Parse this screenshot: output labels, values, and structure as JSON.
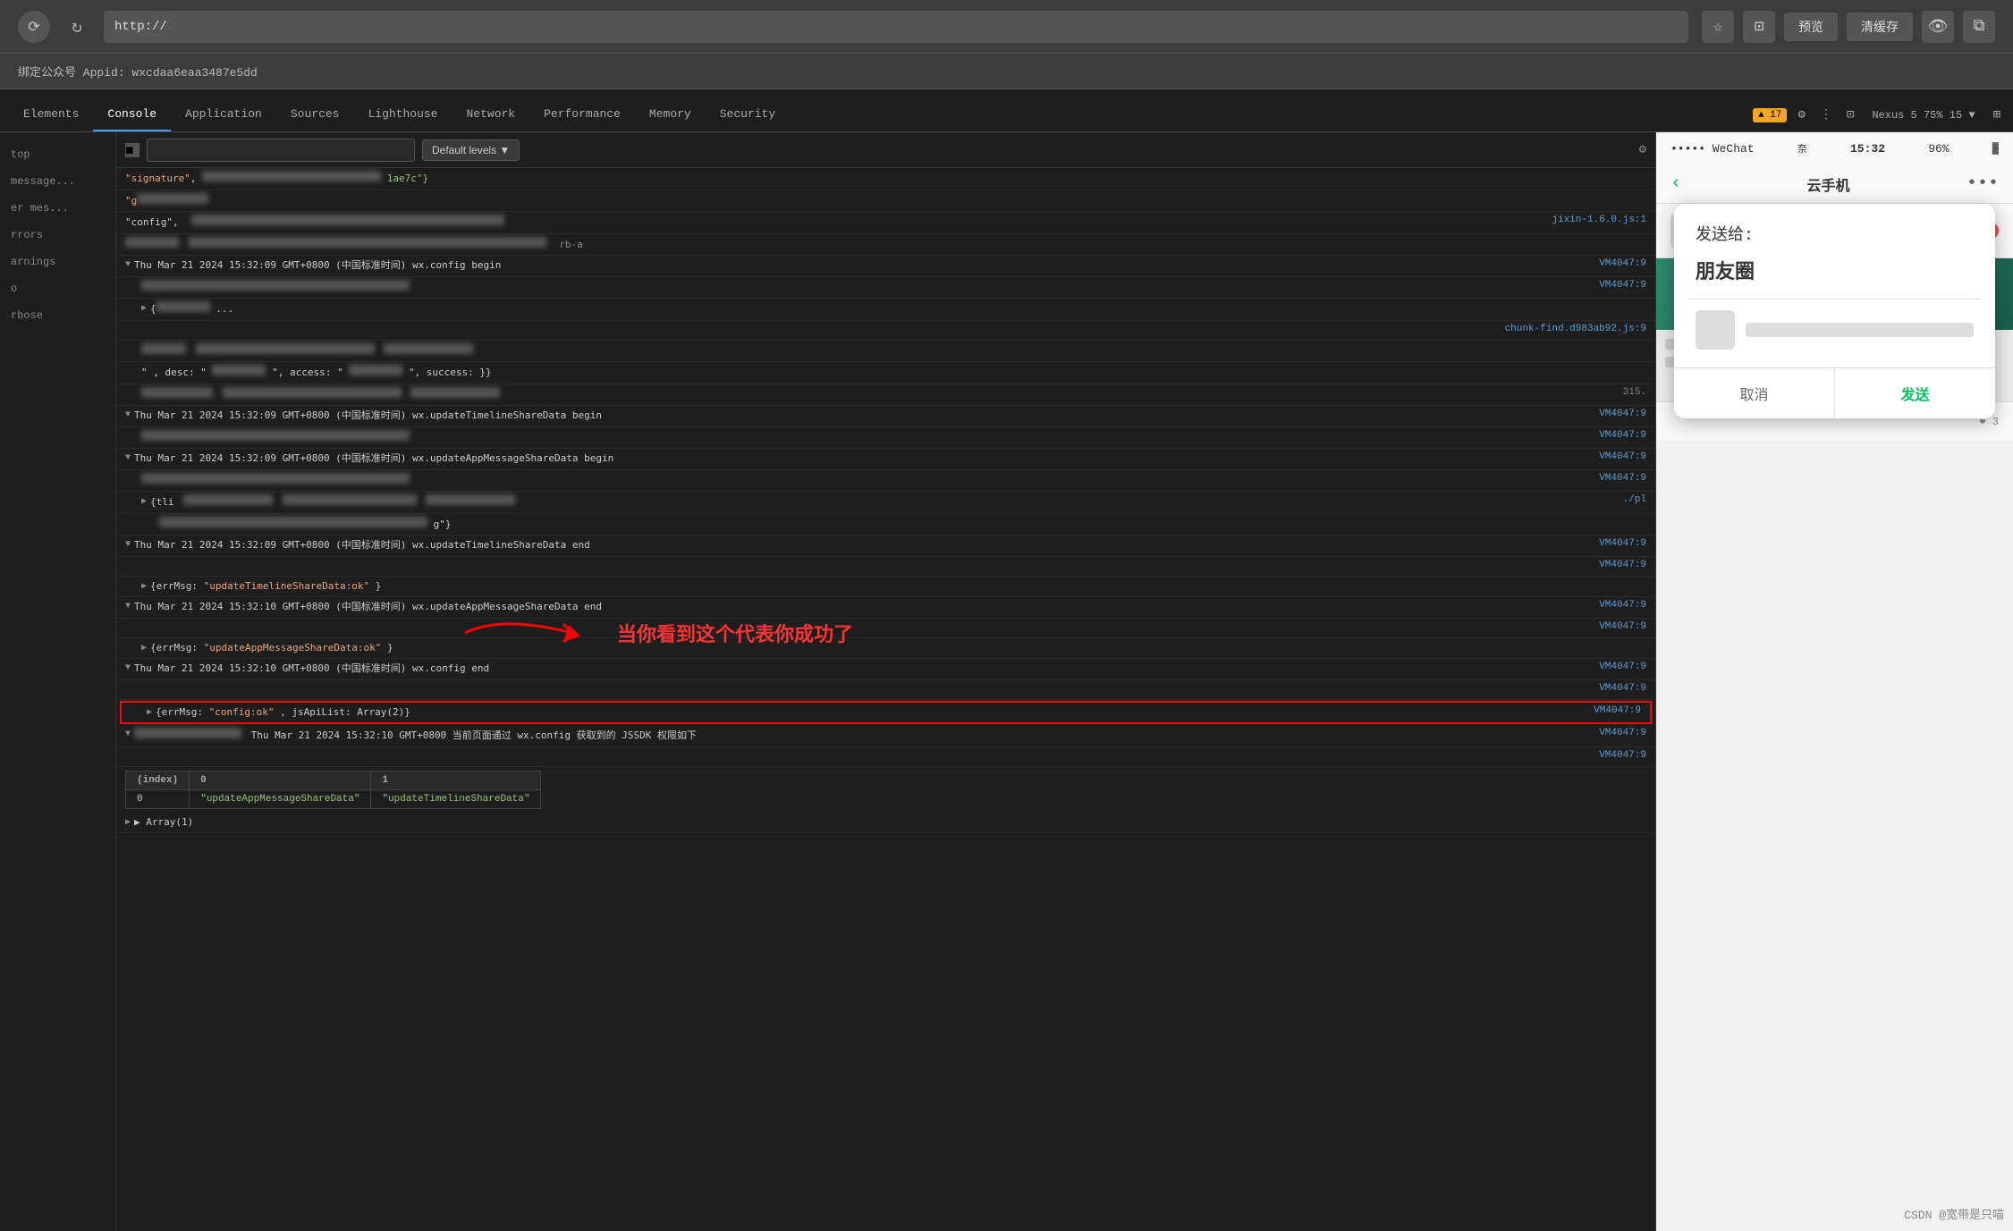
{
  "browser": {
    "url": "http://",
    "appid_label": "绑定公众号 Appid: wxcdaa6eaa3487e5dd",
    "preview_label": "预览",
    "clear_label": "清缓存"
  },
  "devtools": {
    "tabs": [
      {
        "id": "elements",
        "label": "Elements"
      },
      {
        "id": "console",
        "label": "Console",
        "active": true
      },
      {
        "id": "application",
        "label": "Application"
      },
      {
        "id": "sources",
        "label": "Sources"
      },
      {
        "id": "lighthouse",
        "label": "Lighthouse"
      },
      {
        "id": "network",
        "label": "Network"
      },
      {
        "id": "performance",
        "label": "Performance"
      },
      {
        "id": "memory",
        "label": "Memory"
      },
      {
        "id": "security",
        "label": "Security"
      }
    ],
    "warning_count": "▲ 17",
    "nexus_label": "Nexus 5 75% 15 ▼"
  },
  "sidebar": {
    "items": [
      {
        "label": "top"
      },
      {
        "label": "message..."
      },
      {
        "label": "er mes..."
      },
      {
        "label": "rrors"
      },
      {
        "label": "arnings"
      },
      {
        "label": "o"
      },
      {
        "label": "rbose"
      }
    ]
  },
  "console": {
    "filter_placeholder": "",
    "default_levels": "Default levels ▼",
    "entries": [
      {
        "type": "blurred",
        "content": "\"signature\", ...",
        "source": ""
      },
      {
        "type": "blurred",
        "content": "\"gs...\"",
        "source": ""
      },
      {
        "type": "normal",
        "content": "\"config\",",
        "source": "jixin-1.6.0.js:1",
        "extra": "rb-a"
      },
      {
        "type": "blurred",
        "content": "91be...",
        "source": ""
      },
      {
        "type": "group",
        "arrow": "▼",
        "content": "Thu Mar 21 2024 15:32:09 GMT+0800 (中国标准时间) wx.config begin",
        "source": "VM4047:9"
      },
      {
        "type": "sub",
        "content": "",
        "source": "VM4047:9"
      },
      {
        "type": "sub2",
        "content": "{a...",
        "source": ""
      },
      {
        "type": "normal",
        "content": "chunk-find.d983ab92.js:9",
        "source": ""
      },
      {
        "type": "blurred2",
        "content": "fn...",
        "source": ""
      },
      {
        "type": "normal2",
        "content": "\" , desc: \"...\", access: \"...\", success: }}",
        "source": ""
      },
      {
        "type": "sub",
        "content": "She...",
        "source": ""
      },
      {
        "type": "group",
        "arrow": "▼",
        "content": "Thu Mar 21 2024 15:32:09 GMT+0800 (中国标准时间) wx.updateTimelineShareData begin",
        "source": "VM4047:9"
      },
      {
        "type": "sub",
        "content": "",
        "source": "VM4047:9"
      },
      {
        "type": "group",
        "arrow": "▼",
        "content": "Thu Mar 21 2024 15:32:09 GMT+0800 (中国标准时间) wx.updateAppMessageShareData begin",
        "source": "VM4047:9"
      },
      {
        "type": "sub",
        "content": "",
        "source": "VM4047:9"
      },
      {
        "type": "sub2",
        "content": "{tli...",
        "source": "./pl"
      },
      {
        "type": "blurred3",
        "content": "g\"}",
        "source": ""
      },
      {
        "type": "group",
        "arrow": "▼",
        "content": "Thu Mar 21 2024 15:32:09 GMT+0800 (中国标准时间) wx.updateTimelineShareData end",
        "source": "VM4047:9"
      },
      {
        "type": "sub",
        "content": "",
        "source": "VM4047:9"
      },
      {
        "type": "sub3",
        "arrow": "▶",
        "content": "{errMsg: \"updateTimelineShareData:ok\"}",
        "source": ""
      },
      {
        "type": "group",
        "arrow": "▼",
        "content": "Thu Mar 21 2024 15:32:10 GMT+0800 (中国标准时间) wx.updateAppMessageShareData end",
        "source": "VM4047:9"
      },
      {
        "type": "sub",
        "content": "",
        "source": "VM4047:9"
      },
      {
        "type": "sub3",
        "arrow": "▶",
        "content": "{errMsg: \"updateAppMessageShareData:ok\"}",
        "source": ""
      },
      {
        "type": "group",
        "arrow": "▼",
        "content": "Thu Mar 21 2024 15:32:10 GMT+0800 (中国标准时间) wx.config end",
        "source": "VM4047:9"
      },
      {
        "type": "sub",
        "content": "",
        "source": "VM4047:9"
      },
      {
        "type": "sub3_red",
        "arrow": "▶",
        "content": "{errMsg: \"config:ok\", jsApiList: Array(2)}",
        "source": "VM4047:9"
      },
      {
        "type": "group",
        "arrow": "▼",
        "content": "Thu Mar 21 2024 15:32:10 GMT+0800 (中国标准时间) 当前页面通过 wx.config 获取到的 JSSDK 权限如下",
        "source": "VM4047:9"
      },
      {
        "type": "sub",
        "content": "",
        "source": "VM4047:9"
      }
    ],
    "table": {
      "headers": [
        "(index)",
        "0",
        "1"
      ],
      "rows": [
        [
          "0",
          "\"updateAppMessageShareData\"",
          "\"updateTimelineShareData\""
        ]
      ]
    },
    "array_label": "▶ Array(1)"
  },
  "annotation": {
    "text": "当你看到这个代表你成功了"
  },
  "phone": {
    "dots": "••••• WeChat",
    "wifi": "奈",
    "time": "15:32",
    "battery": "96%",
    "title": "云手机",
    "share_to": "发送给:",
    "friend_circle": "朋友圈",
    "cancel": "取消",
    "send": "发送",
    "likes": "❤ 3"
  },
  "footer": {
    "csdn": "CSDN @宽带是只喵"
  }
}
